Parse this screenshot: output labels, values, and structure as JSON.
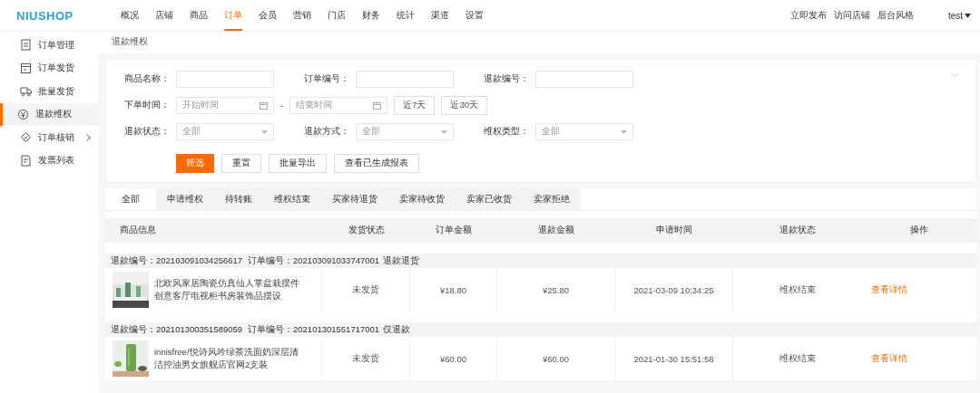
{
  "brand": "NIUSHOP",
  "nav": [
    {
      "label": "概况",
      "selected": false
    },
    {
      "label": "店铺",
      "selected": false
    },
    {
      "label": "商品",
      "selected": false
    },
    {
      "label": "订单",
      "selected": true
    },
    {
      "label": "会员",
      "selected": false
    },
    {
      "label": "营销",
      "selected": false
    },
    {
      "label": "门店",
      "selected": false
    },
    {
      "label": "财务",
      "selected": false
    },
    {
      "label": "统计",
      "selected": false
    },
    {
      "label": "渠道",
      "selected": false
    },
    {
      "label": "设置",
      "selected": false
    }
  ],
  "header_links": [
    "立即发布",
    "访问店铺",
    "后台风格"
  ],
  "user": {
    "name": "test"
  },
  "sidebar": {
    "items": [
      {
        "label": "订单管理",
        "selected": false,
        "kind": "link"
      },
      {
        "label": "订单发货",
        "selected": false,
        "kind": "link"
      },
      {
        "label": "批量发货",
        "selected": false,
        "kind": "link"
      },
      {
        "label": "退款维权",
        "selected": true,
        "kind": "link"
      },
      {
        "label": "订单核销",
        "selected": false,
        "kind": "group"
      },
      {
        "label": "发票列表",
        "selected": false,
        "kind": "link"
      }
    ]
  },
  "breadcrumb": "退款维权",
  "filters": {
    "fields": [
      {
        "kind": "text",
        "label": "商品名称："
      },
      {
        "kind": "text",
        "label": "订单编号："
      },
      {
        "kind": "text",
        "label": "退款编号："
      },
      {
        "kind": "daterange",
        "label": "下单时间：",
        "start_placeholder": "开始时间",
        "separator": "-",
        "end_placeholder": "结束时间",
        "quick": [
          "近7天",
          "近30天"
        ]
      },
      {
        "kind": "select",
        "label": "退款状态：",
        "value": "全部"
      },
      {
        "kind": "select",
        "label": "退款方式：",
        "value": "全部"
      },
      {
        "kind": "select",
        "label": "维权类型：",
        "value": "全部"
      }
    ],
    "buttons": [
      {
        "label": "筛选",
        "kind": "primary"
      },
      {
        "label": "重置",
        "kind": "plain"
      },
      {
        "label": "批量导出",
        "kind": "plain"
      },
      {
        "label": "查看已生成报表",
        "kind": "plain"
      }
    ]
  },
  "tabs": [
    {
      "label": "全部",
      "selected": true
    },
    {
      "label": "申请维权",
      "selected": false
    },
    {
      "label": "待转账",
      "selected": false
    },
    {
      "label": "维权结束",
      "selected": false
    },
    {
      "label": "买家待退货",
      "selected": false
    },
    {
      "label": "卖家待收货",
      "selected": false
    },
    {
      "label": "卖家已收货",
      "selected": false
    },
    {
      "label": "卖家拒绝",
      "selected": false
    }
  ],
  "table": {
    "columns": [
      "商品信息",
      "发货状态",
      "订单金额",
      "退款金额",
      "申请时间",
      "退款状态",
      "操作"
    ],
    "rows": [
      {
        "refund_no": "退款编号：202103091034256617",
        "order_no": "订单编号：202103091033747001",
        "refund_type": "退款退货",
        "product": "北欧风家居陶瓷仿真仙人掌盆栽摆件创意客厅电视柜书房装饰品摆设",
        "shipping": "未发货",
        "order_amount": "¥18.80",
        "refund_amount": "¥25.80",
        "time": "2021-03-09 10:34:25",
        "status": "维权结束",
        "action": "查看详情"
      },
      {
        "refund_no": "退款编号：202101300351589059",
        "order_no": "订单编号：202101301551717001",
        "refund_type": "仅退款",
        "product": "innisfree/悦诗风吟绿茶洗面奶深层清洁控油男女旗舰店官网2支装",
        "shipping": "未发货",
        "order_amount": "¥60.00",
        "refund_amount": "¥60.00",
        "time": "2021-01-30 15:51:58",
        "status": "维权结束",
        "action": "查看详情"
      }
    ]
  }
}
